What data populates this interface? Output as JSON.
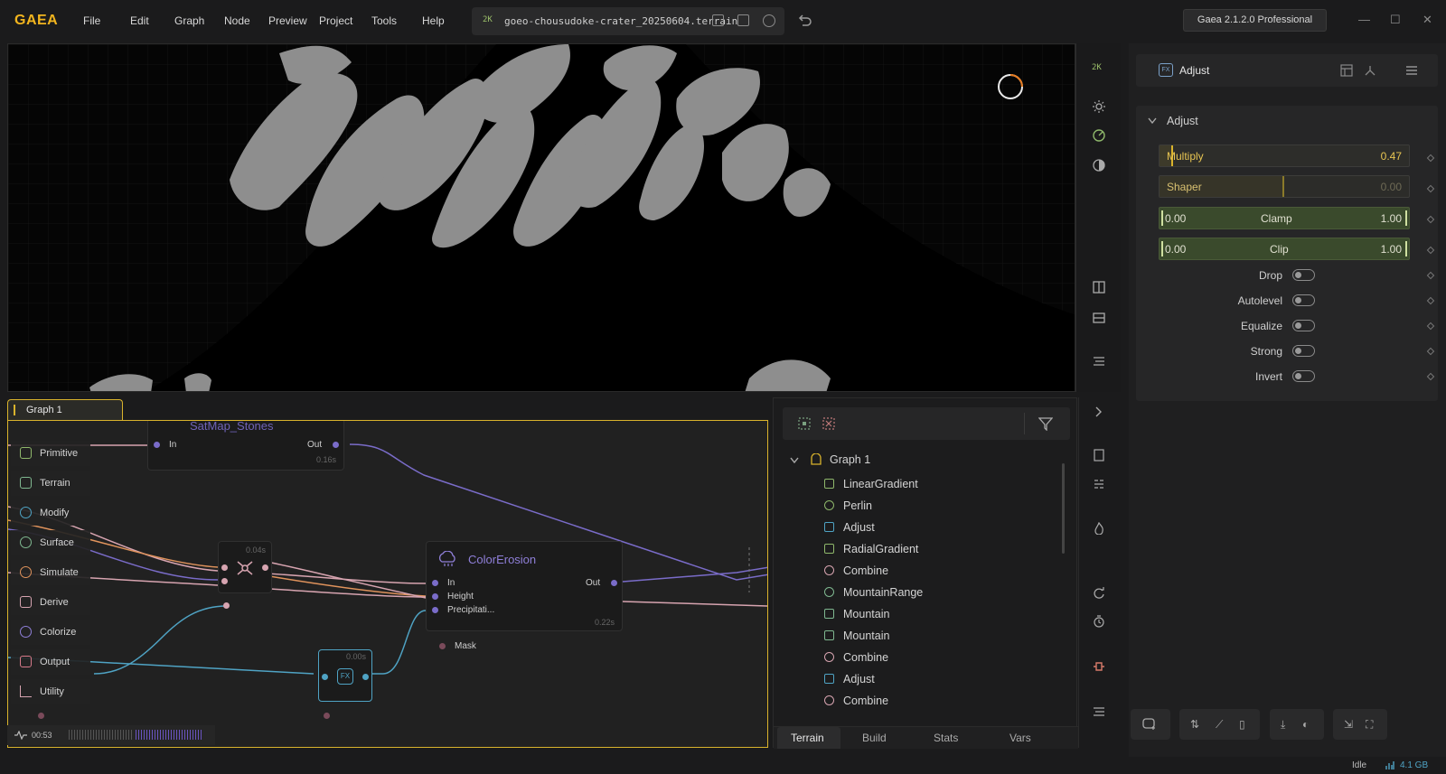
{
  "app": {
    "logo": "GAEA",
    "menu": [
      "File",
      "Edit",
      "Graph",
      "Node",
      "Preview",
      "Project",
      "Tools",
      "Help"
    ],
    "resolution_badge": "2K",
    "filename": "goeo-chousudoke-crater_20250604.terrain",
    "version": "Gaea 2.1.2.0 Professional"
  },
  "viewport": {
    "resolution_badge": "2K"
  },
  "properties": {
    "header_title": "Adjust",
    "section_title": "Adjust",
    "multiply": {
      "label": "Multiply",
      "value": "0.47"
    },
    "shaper": {
      "label": "Shaper",
      "value": "0.00"
    },
    "clamp": {
      "label": "Clamp",
      "min": "0.00",
      "max": "1.00"
    },
    "clip": {
      "label": "Clip",
      "min": "0.00",
      "max": "1.00"
    },
    "toggles": [
      "Drop",
      "Autolevel",
      "Equalize",
      "Strong",
      "Invert"
    ]
  },
  "graph": {
    "tab_label": "Graph 1",
    "palette": [
      "Primitive",
      "Terrain",
      "Modify",
      "Surface",
      "Simulate",
      "Derive",
      "Colorize",
      "Output",
      "Utility"
    ],
    "nodes": {
      "satmap": {
        "title": "SatMap_Stones",
        "in": "In",
        "out": "Out",
        "time": "0.16s"
      },
      "combine_small": {
        "time": "0.04s"
      },
      "colorerosion": {
        "title": "ColorErosion",
        "in": "In",
        "height": "Height",
        "precip": "Precipitati...",
        "out": "Out",
        "time": "0.22s",
        "mask": "Mask"
      },
      "fx_small": {
        "time": "0.00s"
      }
    },
    "status_time": "00:53"
  },
  "node_list": {
    "root": "Graph 1",
    "items": [
      "LinearGradient",
      "Perlin",
      "Adjust",
      "RadialGradient",
      "Combine",
      "MountainRange",
      "Mountain",
      "Mountain",
      "Combine",
      "Adjust",
      "Combine"
    ],
    "tabs": [
      "Terrain",
      "Build",
      "Stats",
      "Vars"
    ]
  },
  "status": {
    "state": "Idle",
    "memory": "4.1 GB"
  }
}
